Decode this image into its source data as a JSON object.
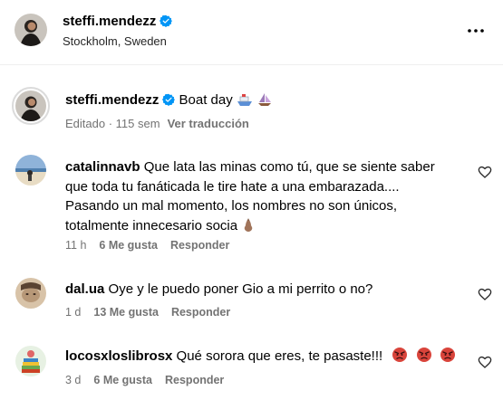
{
  "header": {
    "username": "steffi.mendezz",
    "location": "Stockholm, Sweden",
    "more_icon": "more-horizontal-icon"
  },
  "caption": {
    "username": "steffi.mendezz",
    "text": "Boat day",
    "emojis": [
      "ship-emoji",
      "sailboat-emoji"
    ],
    "edited": "Editado",
    "time": "115 sem",
    "see_translation": "Ver traducción"
  },
  "comments": [
    {
      "username": "catalinnavb",
      "text": "Que lata las minas como tú, que se siente saber que toda tu fanáticada le tire hate a una embarazada.... Pasando un mal momento, los nombres no son únicos, totalmente innecesario socia",
      "emoji": "pinched-fingers-emoji",
      "time": "11 h",
      "likes": "6 Me gusta",
      "reply": "Responder"
    },
    {
      "username": "dal.ua",
      "text": "Oye y le puedo poner Gio a mi perrito o no?",
      "time": "1 d",
      "likes": "13 Me gusta",
      "reply": "Responder"
    },
    {
      "username": "locosxloslibrosx",
      "text": "Qué sorora que eres, te pasaste!!!",
      "emoji": "angry-face-emoji",
      "time": "3 d",
      "likes": "6 Me gusta",
      "reply": "Responder"
    }
  ],
  "colors": {
    "verified": "#0095f6",
    "secondary_text": "#737373",
    "divider": "#efefef"
  }
}
